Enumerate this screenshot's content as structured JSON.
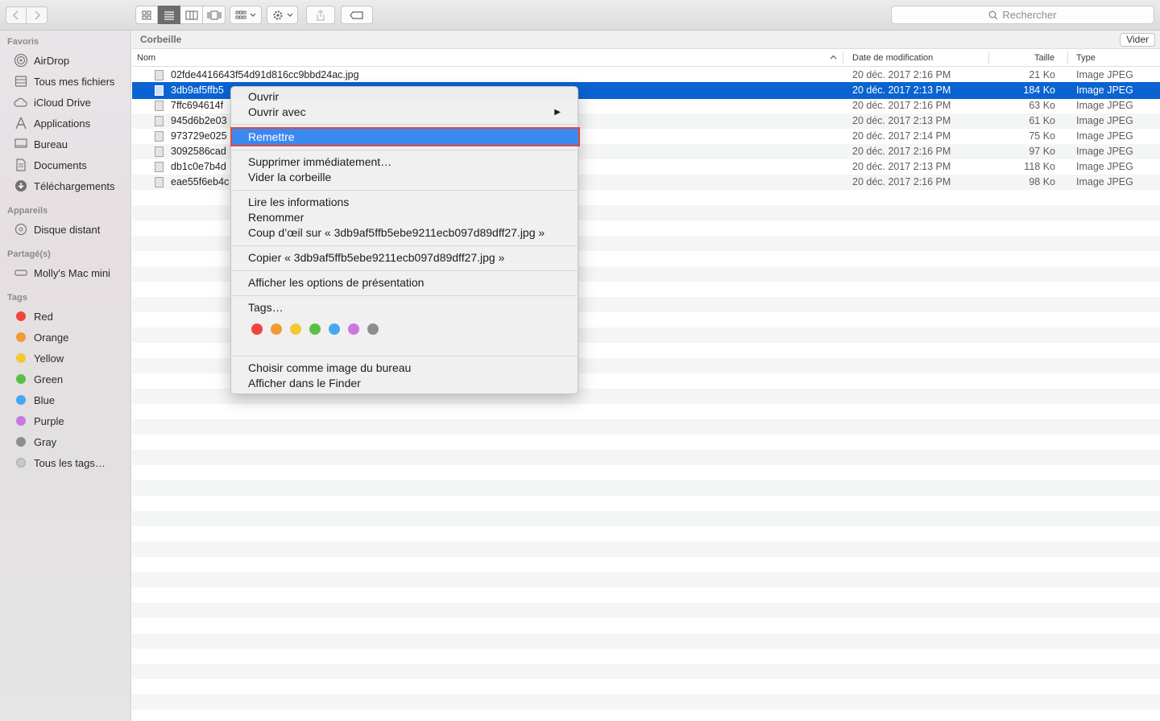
{
  "toolbar": {
    "back_icon": "chevron-left-icon",
    "forward_icon": "chevron-right-icon",
    "view_modes": [
      "icon-view",
      "list-view",
      "column-view",
      "cover-flow-view"
    ],
    "active_view": "list-view",
    "search_placeholder": "Rechercher"
  },
  "sidebar": {
    "favorites_title": "Favoris",
    "favorites": [
      {
        "label": "AirDrop",
        "icon": "airdrop-icon"
      },
      {
        "label": "Tous mes fichiers",
        "icon": "all-files-icon"
      },
      {
        "label": "iCloud Drive",
        "icon": "cloud-icon"
      },
      {
        "label": "Applications",
        "icon": "applications-icon"
      },
      {
        "label": "Bureau",
        "icon": "desktop-icon"
      },
      {
        "label": "Documents",
        "icon": "document-icon"
      },
      {
        "label": "Téléchargements",
        "icon": "download-icon"
      }
    ],
    "devices_title": "Appareils",
    "devices": [
      {
        "label": "Disque distant",
        "icon": "disc-icon"
      }
    ],
    "shared_title": "Partagé(s)",
    "shared": [
      {
        "label": "Molly's Mac mini",
        "icon": "computer-icon"
      }
    ],
    "tags_title": "Tags",
    "tags": [
      {
        "label": "Red",
        "color": "#f0453c"
      },
      {
        "label": "Orange",
        "color": "#f59a32"
      },
      {
        "label": "Yellow",
        "color": "#f4c830"
      },
      {
        "label": "Green",
        "color": "#5ac045"
      },
      {
        "label": "Blue",
        "color": "#45a8f0"
      },
      {
        "label": "Purple",
        "color": "#c878e0"
      },
      {
        "label": "Gray",
        "color": "#8e8e8e"
      },
      {
        "label": "Tous les tags…",
        "color": "#c8c8c8"
      }
    ]
  },
  "main": {
    "title": "Corbeille",
    "empty_button": "Vider",
    "columns": {
      "name": "Nom",
      "date": "Date de modification",
      "size": "Taille",
      "type": "Type"
    },
    "files": [
      {
        "name": "02fde4416643f54d91d816cc9bbd24ac.jpg",
        "date": "20 déc. 2017 2:16 PM",
        "size": "21 Ko",
        "type": "Image JPEG"
      },
      {
        "name": "3db9af5ffb5",
        "date": "20 déc. 2017 2:13 PM",
        "size": "184 Ko",
        "type": "Image JPEG",
        "selected": true
      },
      {
        "name": "7ffc694614f",
        "date": "20 déc. 2017 2:16 PM",
        "size": "63 Ko",
        "type": "Image JPEG"
      },
      {
        "name": "945d6b2e03",
        "date": "20 déc. 2017 2:13 PM",
        "size": "61 Ko",
        "type": "Image JPEG"
      },
      {
        "name": "973729e025",
        "date": "20 déc. 2017 2:14 PM",
        "size": "75 Ko",
        "type": "Image JPEG"
      },
      {
        "name": "3092586cad",
        "date": "20 déc. 2017 2:16 PM",
        "size": "97 Ko",
        "type": "Image JPEG"
      },
      {
        "name": "db1c0e7b4d",
        "date": "20 déc. 2017 2:13 PM",
        "size": "118 Ko",
        "type": "Image JPEG"
      },
      {
        "name": "eae55f6eb4c",
        "date": "20 déc. 2017 2:16 PM",
        "size": "98 Ko",
        "type": "Image JPEG"
      }
    ]
  },
  "context_menu": {
    "open": "Ouvrir",
    "open_with": "Ouvrir avec",
    "put_back": "Remettre",
    "delete_now": "Supprimer immédiatement…",
    "empty_trash": "Vider la corbeille",
    "get_info": "Lire les informations",
    "rename": "Renommer",
    "quick_look": "Coup d’œil sur « 3db9af5ffb5ebe9211ecb097d89dff27.jpg »",
    "copy": "Copier « 3db9af5ffb5ebe9211ecb097d89dff27.jpg »",
    "view_options": "Afficher les options de présentation",
    "tags": "Tags…",
    "tag_colors": [
      "#f0453c",
      "#f59a32",
      "#f4c830",
      "#5ac045",
      "#45a8f0",
      "#c878e0",
      "#8e8e8e"
    ],
    "set_desktop": "Choisir comme image du bureau",
    "show_in_finder": "Afficher dans le Finder"
  }
}
